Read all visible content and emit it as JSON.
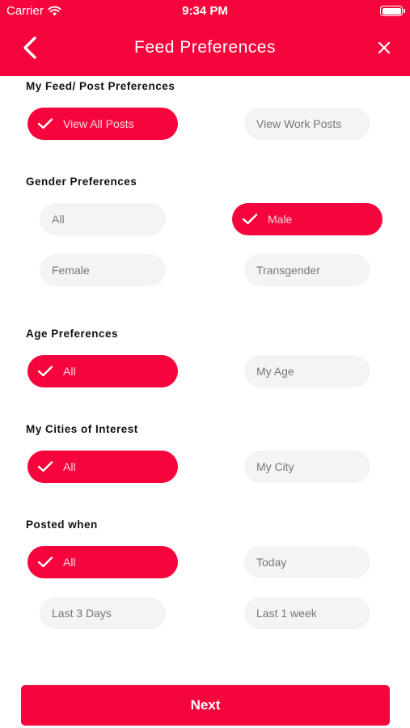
{
  "status_bar": {
    "carrier": "Carrier",
    "time": "9:34 PM"
  },
  "header": {
    "title": "Feed Preferences"
  },
  "colors": {
    "accent": "#f5053c",
    "chip_bg": "#f4f4f4"
  },
  "sections": [
    {
      "title": "My Feed/ Post Preferences",
      "options": [
        {
          "label": "View All Posts",
          "selected": true
        },
        {
          "label": "View Work Posts",
          "selected": false
        }
      ]
    },
    {
      "title": "Gender Preferences",
      "options": [
        {
          "label": "All",
          "selected": false
        },
        {
          "label": "Male",
          "selected": true
        },
        {
          "label": "Female",
          "selected": false
        },
        {
          "label": "Transgender",
          "selected": false
        }
      ]
    },
    {
      "title": "Age Preferences",
      "options": [
        {
          "label": "All",
          "selected": true
        },
        {
          "label": "My Age",
          "selected": false
        }
      ]
    },
    {
      "title": "My Cities of Interest",
      "options": [
        {
          "label": "All",
          "selected": true
        },
        {
          "label": "My City",
          "selected": false
        }
      ]
    },
    {
      "title": "Posted when",
      "options": [
        {
          "label": "All",
          "selected": true
        },
        {
          "label": "Today",
          "selected": false
        },
        {
          "label": "Last 3 Days",
          "selected": false
        },
        {
          "label": "Last 1 week",
          "selected": false
        }
      ]
    }
  ],
  "footer": {
    "next_label": "Next"
  }
}
